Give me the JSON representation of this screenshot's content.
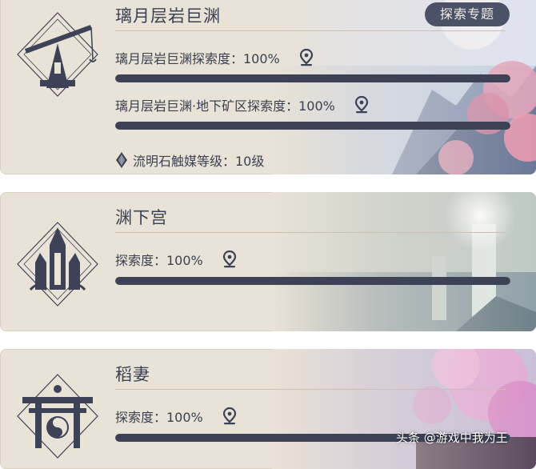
{
  "areas": [
    {
      "title": "璃月层岩巨渊",
      "rows": [
        {
          "label": "璃月层岩巨渊探索度：100%",
          "progress": 1.0
        },
        {
          "label": "璃月层岩巨渊·地下矿区探索度：100%",
          "progress": 1.0
        }
      ],
      "catalyst": "流明石触媒等级：10级",
      "topic_button": "探索专题",
      "emblem_icon": "crane-tower-emblem-icon"
    },
    {
      "title": "渊下宫",
      "rows": [
        {
          "label": "探索度：100%",
          "progress": 1.0
        }
      ],
      "emblem_icon": "spire-emblem-icon"
    },
    {
      "title": "稻妻",
      "rows": [
        {
          "label": "探索度：100%",
          "progress": 1.0
        }
      ],
      "emblem_icon": "torii-emblem-icon"
    }
  ],
  "watermark": "头条 @游戏中我为王",
  "colors": {
    "bar_fill": "#3d4256",
    "card_bg": "#e9e2d6",
    "button_bg": "#4b5166"
  }
}
